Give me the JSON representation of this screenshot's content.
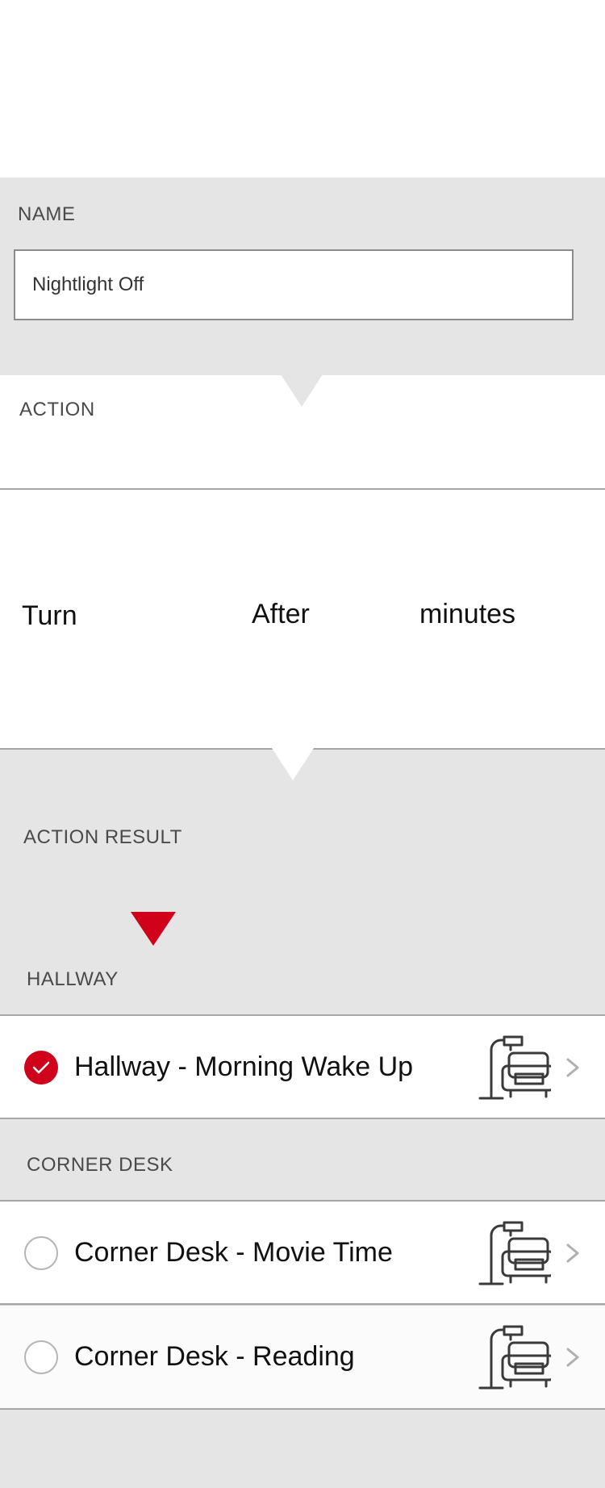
{
  "name_section": {
    "label": "NAME",
    "value": "Nightlight Off"
  },
  "action_section": {
    "label": "ACTION",
    "turn": "Turn",
    "after": "After",
    "minutes": "minutes"
  },
  "result_section": {
    "label": "ACTION RESULT",
    "groups": [
      {
        "title": "HALLWAY",
        "items": [
          {
            "label": "Hallway - Morning Wake Up",
            "selected": true,
            "icon": "lamp-chair-icon"
          }
        ]
      },
      {
        "title": "CORNER DESK",
        "items": [
          {
            "label": "Corner Desk - Movie Time",
            "selected": false,
            "icon": "lamp-chair-icon"
          },
          {
            "label": "Corner Desk - Reading",
            "selected": false,
            "icon": "lamp-chair-icon"
          }
        ]
      }
    ]
  },
  "colors": {
    "accent": "#d0021b",
    "section_bg": "#e5e5e5",
    "divider": "#a6a6a6"
  }
}
